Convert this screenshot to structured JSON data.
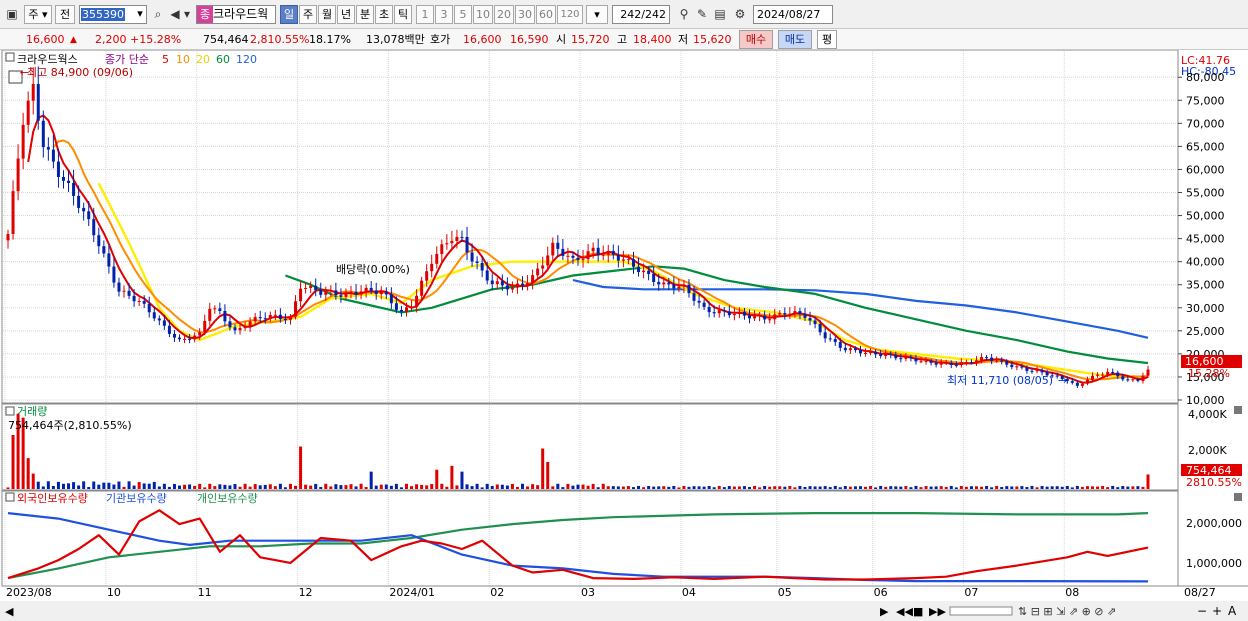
{
  "toolbar": {
    "market": "주",
    "jeon": "전",
    "code": "355390",
    "name": "크라우드웍",
    "name_tag": "종",
    "periods": [
      "일",
      "주",
      "월",
      "년",
      "분",
      "초",
      "틱"
    ],
    "numbers": [
      "1",
      "3",
      "5",
      "10",
      "20",
      "30",
      "60",
      "120"
    ],
    "count": "242/242",
    "date": "2024/08/27"
  },
  "quote": {
    "price": "16,600",
    "change": "2,200 ▲",
    "change_pct": "2,200 +15.28%",
    "volume": "754,464",
    "volume_pct": "2,810.55%",
    "turnover": "18.17%",
    "amount": "13,078백만",
    "hoga_label": "호가",
    "hoga1": "16,600",
    "hoga2": "16,590",
    "open_label": "시",
    "open": "15,720",
    "high_label": "고",
    "high": "18,400",
    "low_label": "저",
    "low": "15,620",
    "buy": "매수",
    "sell": "매도",
    "pyeong": "평"
  },
  "colors": {
    "candle_up": "#e00000",
    "candle_down": "#0022aa",
    "ma5": "#e00000",
    "ma10": "#ff8c00",
    "ma20": "#ffee00",
    "ma60": "#008c3a",
    "ma120": "#2060e0",
    "foreign": "#e00000",
    "institution": "#2050e0",
    "individual": "#209050"
  },
  "chart_data": [
    {
      "type": "candlestick",
      "title": "크라우드웍스",
      "legend": [
        "종가 단순",
        "5",
        "10",
        "20",
        "60",
        "120"
      ],
      "y_ticks": [
        "80,000",
        "75,000",
        "70,000",
        "65,000",
        "60,000",
        "55,000",
        "50,000",
        "45,000",
        "40,000",
        "35,000",
        "30,000",
        "25,000",
        "20,000",
        "15,000",
        "10,000"
      ],
      "ylim": [
        10000,
        82000
      ],
      "x_ticks": [
        "2023/08",
        "10",
        "11",
        "12",
        "2024/01",
        "02",
        "03",
        "04",
        "05",
        "06",
        "07",
        "08",
        "08/27"
      ],
      "lc": "LC:41.76",
      "hc": "HC:-80.45",
      "high_note": "최고 84,900 (09/06)",
      "low_note": "최저 11,710 (08/05)",
      "dividend_note": "배당락(0.00%)",
      "last_price": "16,600",
      "last_pct": "15.28%",
      "close_path": [
        [
          0,
          46000
        ],
        [
          3,
          70000
        ],
        [
          5,
          77000
        ],
        [
          7,
          66000
        ],
        [
          10,
          60000
        ],
        [
          14,
          52000
        ],
        [
          18,
          44000
        ],
        [
          22,
          34000
        ],
        [
          26,
          31000
        ],
        [
          30,
          27000
        ],
        [
          34,
          23000
        ],
        [
          38,
          24000
        ],
        [
          40,
          30000
        ],
        [
          42,
          29000
        ],
        [
          45,
          25000
        ],
        [
          48,
          27000
        ],
        [
          52,
          28000
        ],
        [
          56,
          28000
        ],
        [
          58,
          35000
        ],
        [
          62,
          33000
        ],
        [
          66,
          33000
        ],
        [
          70,
          34000
        ],
        [
          74,
          33000
        ],
        [
          78,
          29000
        ],
        [
          80,
          31000
        ],
        [
          84,
          40000
        ],
        [
          88,
          45000
        ],
        [
          90,
          45000
        ],
        [
          92,
          41000
        ],
        [
          96,
          35000
        ],
        [
          100,
          34000
        ],
        [
          104,
          37000
        ],
        [
          108,
          43000
        ],
        [
          112,
          40000
        ],
        [
          116,
          43000
        ],
        [
          118,
          42000
        ],
        [
          122,
          40000
        ],
        [
          126,
          38000
        ],
        [
          130,
          35000
        ],
        [
          134,
          34000
        ],
        [
          138,
          30000
        ],
        [
          142,
          29000
        ],
        [
          146,
          28000
        ],
        [
          150,
          28000
        ],
        [
          154,
          29000
        ],
        [
          158,
          28000
        ],
        [
          162,
          24000
        ],
        [
          166,
          21000
        ],
        [
          170,
          20000
        ],
        [
          174,
          20000
        ],
        [
          178,
          19000
        ],
        [
          182,
          18000
        ],
        [
          186,
          18000
        ],
        [
          190,
          18000
        ],
        [
          194,
          19000
        ],
        [
          198,
          18000
        ],
        [
          202,
          16500
        ],
        [
          206,
          15500
        ],
        [
          210,
          14500
        ],
        [
          212,
          13000
        ],
        [
          214,
          14500
        ],
        [
          218,
          16000
        ],
        [
          222,
          14500
        ],
        [
          224,
          14400
        ],
        [
          226,
          16600
        ]
      ],
      "ma20": [
        [
          18,
          57000
        ],
        [
          24,
          44000
        ],
        [
          30,
          30000
        ],
        [
          34,
          25000
        ],
        [
          38,
          23000
        ],
        [
          45,
          26000
        ],
        [
          52,
          27000
        ],
        [
          58,
          28000
        ],
        [
          64,
          32000
        ],
        [
          72,
          33000
        ],
        [
          78,
          31000
        ],
        [
          84,
          36000
        ],
        [
          92,
          39000
        ],
        [
          100,
          40000
        ],
        [
          108,
          40000
        ],
        [
          116,
          40000
        ],
        [
          122,
          40000
        ],
        [
          128,
          38000
        ],
        [
          136,
          33000
        ],
        [
          144,
          30000
        ],
        [
          152,
          29000
        ],
        [
          160,
          27000
        ],
        [
          166,
          23000
        ],
        [
          172,
          21000
        ],
        [
          180,
          20000
        ],
        [
          188,
          19000
        ],
        [
          196,
          18500
        ],
        [
          204,
          17500
        ],
        [
          210,
          16500
        ],
        [
          216,
          15500
        ],
        [
          222,
          15000
        ],
        [
          226,
          15000
        ]
      ],
      "ma60": [
        [
          55,
          37000
        ],
        [
          60,
          35000
        ],
        [
          66,
          32000
        ],
        [
          72,
          30500
        ],
        [
          78,
          29000
        ],
        [
          84,
          30000
        ],
        [
          90,
          32000
        ],
        [
          96,
          34000
        ],
        [
          104,
          35000
        ],
        [
          112,
          37000
        ],
        [
          120,
          38000
        ],
        [
          128,
          39000
        ],
        [
          134,
          38500
        ],
        [
          142,
          36000
        ],
        [
          150,
          34500
        ],
        [
          160,
          33000
        ],
        [
          170,
          30000
        ],
        [
          180,
          27500
        ],
        [
          190,
          25000
        ],
        [
          200,
          23000
        ],
        [
          210,
          20500
        ],
        [
          218,
          19000
        ],
        [
          226,
          18000
        ]
      ],
      "ma120": [
        [
          112,
          36000
        ],
        [
          118,
          34500
        ],
        [
          126,
          34000
        ],
        [
          134,
          34000
        ],
        [
          142,
          34000
        ],
        [
          150,
          34000
        ],
        [
          160,
          33800
        ],
        [
          170,
          33000
        ],
        [
          180,
          31500
        ],
        [
          190,
          30500
        ],
        [
          200,
          29000
        ],
        [
          210,
          27000
        ],
        [
          220,
          25000
        ],
        [
          226,
          23500
        ]
      ]
    },
    {
      "type": "bar",
      "title": "거래량",
      "last_volume_label": "754,464주(2,810.55%)",
      "y_ticks": [
        "4,000K",
        "2,000K"
      ],
      "ylim": [
        0,
        4200000
      ],
      "last_value": "754,464",
      "last_pct": "2810.55%"
    },
    {
      "type": "line",
      "title": "외국인보유수량",
      "series": [
        {
          "name": "외국인보유수량",
          "values": [
            [
              0,
              150000
            ],
            [
              6,
              500000
            ],
            [
              10,
              800000
            ],
            [
              14,
              1200000
            ],
            [
              18,
              1700000
            ],
            [
              22,
              1000000
            ],
            [
              26,
              2200000
            ],
            [
              30,
              2600000
            ],
            [
              34,
              2100000
            ],
            [
              38,
              2300000
            ],
            [
              42,
              1100000
            ],
            [
              46,
              1700000
            ],
            [
              50,
              900000
            ],
            [
              56,
              700000
            ],
            [
              62,
              1600000
            ],
            [
              68,
              1500000
            ],
            [
              72,
              800000
            ],
            [
              78,
              1300000
            ],
            [
              82,
              1500000
            ],
            [
              86,
              1400000
            ],
            [
              90,
              1200000
            ],
            [
              94,
              1500000
            ],
            [
              100,
              600000
            ],
            [
              104,
              350000
            ],
            [
              110,
              450000
            ],
            [
              116,
              150000
            ],
            [
              124,
              120000
            ],
            [
              132,
              180000
            ],
            [
              140,
              120000
            ],
            [
              150,
              200000
            ],
            [
              156,
              150000
            ],
            [
              162,
              100000
            ],
            [
              170,
              100000
            ],
            [
              180,
              150000
            ],
            [
              186,
              200000
            ],
            [
              192,
              400000
            ],
            [
              200,
              600000
            ],
            [
              210,
              900000
            ],
            [
              214,
              1100000
            ],
            [
              218,
              950000
            ],
            [
              226,
              1250000
            ]
          ]
        },
        {
          "name": "기관보유수량",
          "values": [
            [
              0,
              2500000
            ],
            [
              10,
              2300000
            ],
            [
              20,
              1900000
            ],
            [
              30,
              1500000
            ],
            [
              36,
              1350000
            ],
            [
              44,
              1500000
            ],
            [
              56,
              1500000
            ],
            [
              70,
              1500000
            ],
            [
              80,
              1700000
            ],
            [
              90,
              1000000
            ],
            [
              100,
              600000
            ],
            [
              110,
              500000
            ],
            [
              120,
              300000
            ],
            [
              130,
              200000
            ],
            [
              150,
              200000
            ],
            [
              160,
              150000
            ],
            [
              170,
              80000
            ],
            [
              180,
              40000
            ],
            [
              200,
              40000
            ],
            [
              226,
              30000
            ]
          ]
        },
        {
          "name": "개인보유수량",
          "values": [
            [
              0,
              150000
            ],
            [
              10,
              500000
            ],
            [
              20,
              900000
            ],
            [
              30,
              1100000
            ],
            [
              40,
              1300000
            ],
            [
              50,
              1300000
            ],
            [
              60,
              1400000
            ],
            [
              70,
              1400000
            ],
            [
              80,
              1600000
            ],
            [
              90,
              1900000
            ],
            [
              100,
              2100000
            ],
            [
              110,
              2250000
            ],
            [
              120,
              2350000
            ],
            [
              140,
              2450000
            ],
            [
              160,
              2500000
            ],
            [
              180,
              2500000
            ],
            [
              200,
              2450000
            ],
            [
              220,
              2450000
            ],
            [
              226,
              2500000
            ]
          ]
        }
      ],
      "y_ticks": [
        "2,000,000",
        "1,000,000"
      ],
      "ylim": [
        -100000,
        2900000
      ]
    }
  ]
}
